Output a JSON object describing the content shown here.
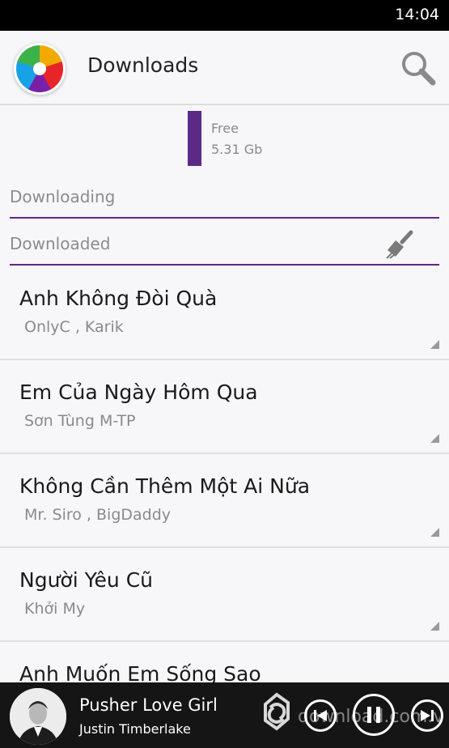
{
  "status_bar": {
    "time": "14:04"
  },
  "header": {
    "title": "Downloads",
    "search_icon": "search-icon",
    "logo_icon": "app-logo-icon"
  },
  "storage": {
    "label": "Free",
    "value": "5.31 Gb",
    "bar_color": "#5b2a86"
  },
  "sections": {
    "downloading": "Downloading",
    "downloaded": "Downloaded",
    "clean_icon": "broom-icon"
  },
  "songs": [
    {
      "title": "Anh Không Đòi Quà",
      "artist": "OnlyC , Karik"
    },
    {
      "title": "Em Của Ngày Hôm Qua",
      "artist": "Sơn Tùng M-TP"
    },
    {
      "title": "Không Cần Thêm Một Ai Nữa",
      "artist": "Mr. Siro , BigDaddy"
    },
    {
      "title": "Người Yêu Cũ",
      "artist": "Khởi My"
    },
    {
      "title": "Anh Muốn Em Sống Sao",
      "artist": ""
    }
  ],
  "now_playing": {
    "title": "Pusher Love Girl",
    "artist": "Justin Timberlake",
    "controls": [
      "previous-icon",
      "pause-icon",
      "next-icon"
    ]
  },
  "watermark": {
    "text": "download.com.vn",
    "icon": "watermark-logo-icon"
  },
  "colors": {
    "accent": "#5b2a86",
    "background": "#f7f6f9",
    "player_bg": "#151515"
  }
}
